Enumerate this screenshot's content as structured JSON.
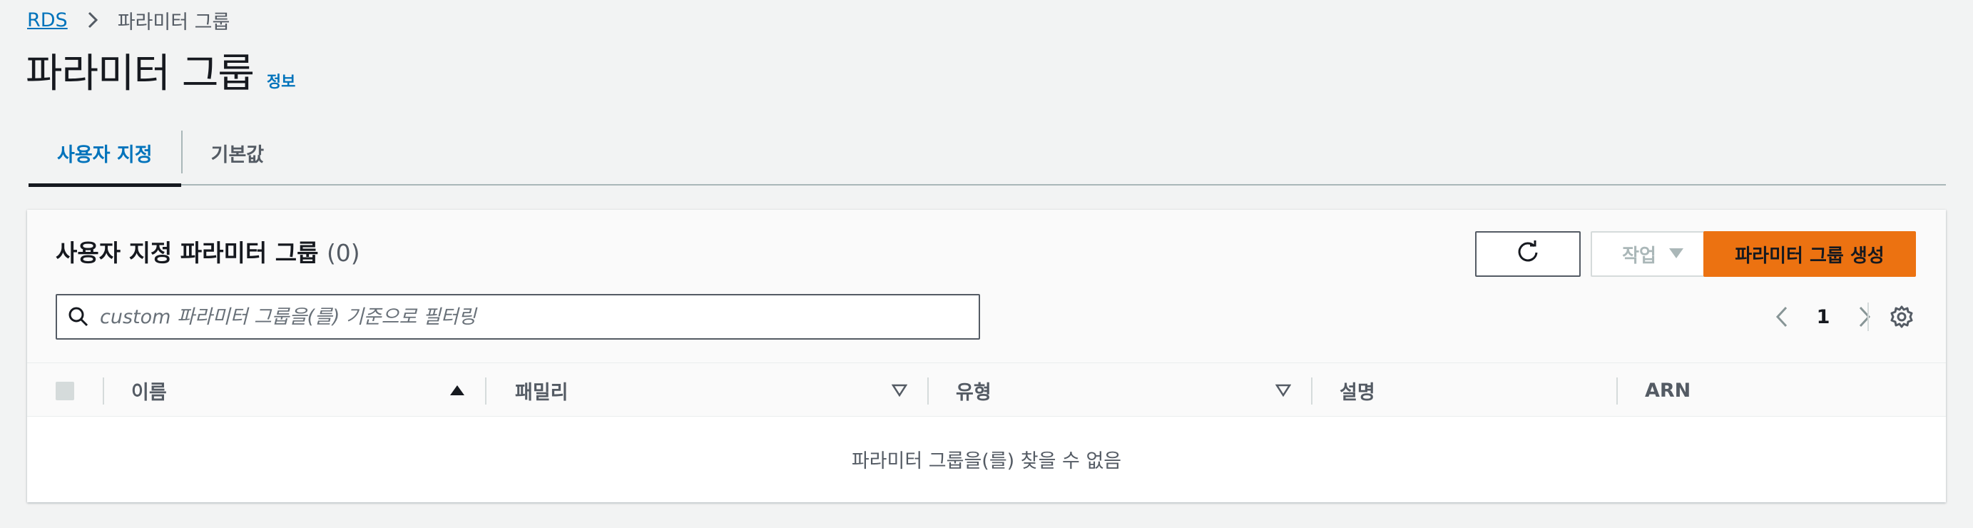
{
  "breadcrumb": {
    "root": "RDS",
    "current": "파라미터 그룹"
  },
  "page": {
    "title": "파라미터 그룹",
    "info": "정보"
  },
  "tabs": [
    {
      "label": "사용자 지정",
      "active": true
    },
    {
      "label": "기본값",
      "active": false
    }
  ],
  "container": {
    "title": "사용자 지정 파라미터 그룹",
    "count": "(0)",
    "actions_label": "작업",
    "create_label": "파라미터 그룹 생성",
    "search_placeholder": "custom 파라미터 그룹을(를) 기준으로 필터링",
    "page_number": "1"
  },
  "table": {
    "columns": [
      "이름",
      "패밀리",
      "유형",
      "설명",
      "ARN"
    ],
    "empty_text": "파라미터 그룹을(를) 찾을 수 없음"
  },
  "colors": {
    "accent": "#0073bb",
    "primary_button": "#ec7211",
    "background": "#f2f3f3"
  },
  "icons": [
    "chevron-right-icon",
    "refresh-icon",
    "caret-down-icon",
    "search-icon",
    "chevron-left-icon",
    "gear-icon",
    "sort-ascending-icon",
    "sort-descending-icon"
  ]
}
